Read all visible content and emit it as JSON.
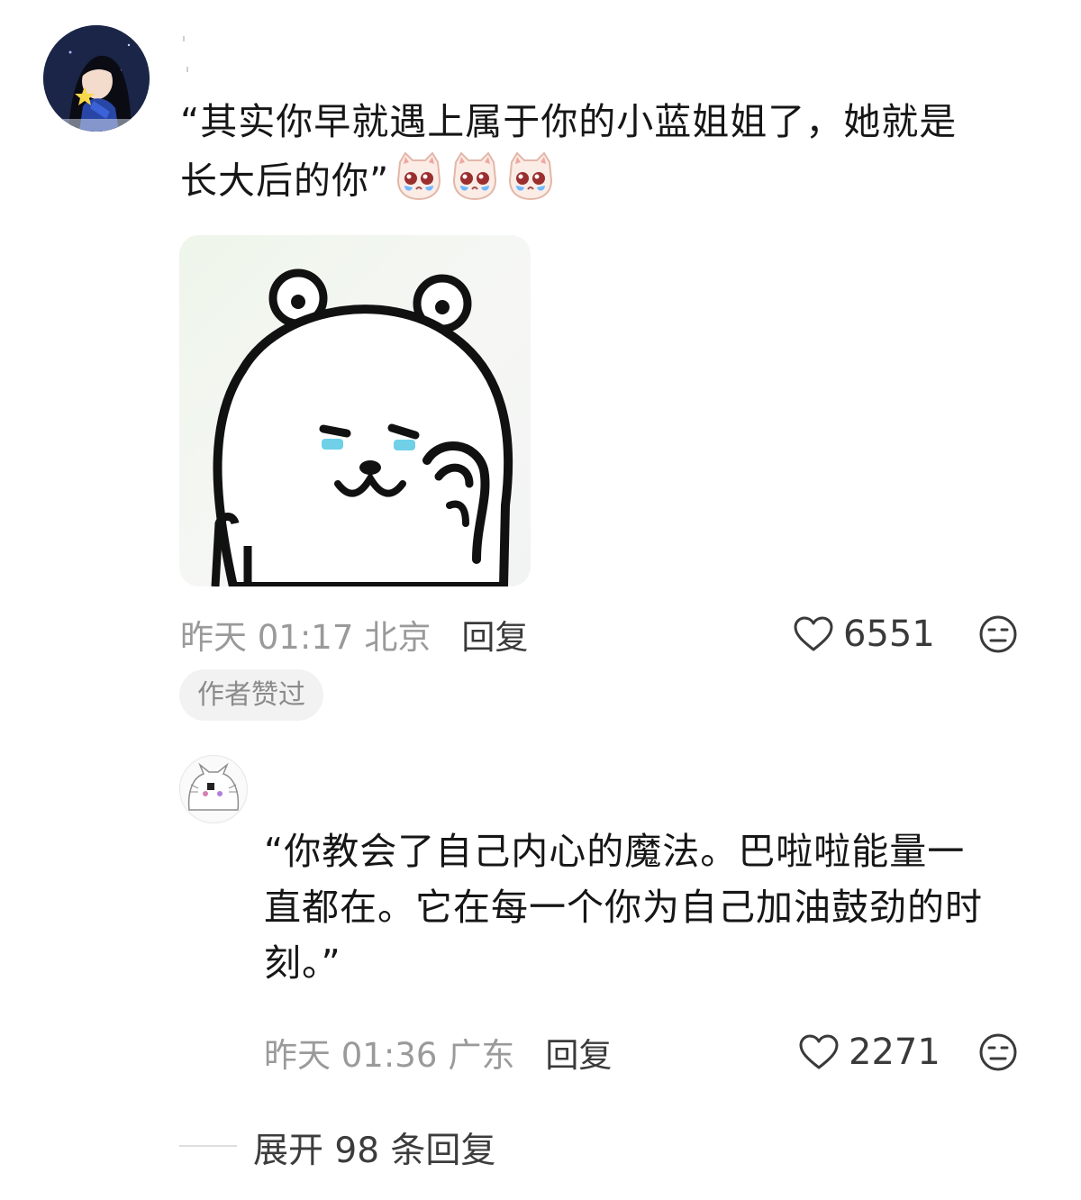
{
  "comment": {
    "username": "",
    "text_line1": "“其实你早就遇上属于你的小蓝姐姐了，她就是",
    "text_line2": "长大后的你”",
    "inline_emojis": [
      "crying-cat-emoji",
      "crying-cat-emoji",
      "crying-cat-emoji"
    ],
    "sticker": "crying-bear-sticker",
    "time": "昨天 01:17",
    "location": "北京",
    "reply_label": "回复",
    "like_count": "6551",
    "badge": "作者赞过"
  },
  "reply": {
    "text_line1": "“你教会了自己内心的魔法。巴啦啦能量一",
    "text_line2": "直都在。它在每一个你为自己加油鼓劲的时",
    "text_line3": "刻。”",
    "time": "昨天 01:36",
    "location": "广东",
    "reply_label": "回复",
    "like_count": "2271"
  },
  "expand": {
    "label": "展开 98 条回复"
  },
  "colors": {
    "text": "#161616",
    "meta": "#9a9a9a",
    "badge_bg": "#f2f2f2",
    "tear_blue": "#6fd0e8"
  }
}
